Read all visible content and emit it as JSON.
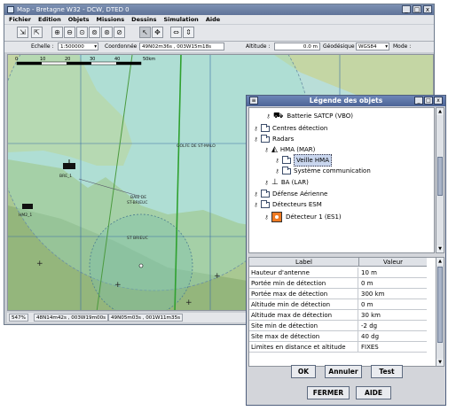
{
  "window": {
    "title": "Map - Bretagne W32 - DCW, DTED 0",
    "minimize": "_",
    "maximize": "□",
    "close": "x"
  },
  "menu": [
    "Fichier",
    "Edition",
    "Objets",
    "Missions",
    "Dessins",
    "Simulation",
    "Aide"
  ],
  "infobar": {
    "scale_label": "Echelle :",
    "scale_value": "1:500000",
    "coord_label": "Coordonnée :",
    "coord_value": "49N02m36s , 003W15m18s",
    "altitude_label": "Altitude :",
    "altitude_value": "0.0 m",
    "geodesic_label": "Géodésique :",
    "geodesic_value": "WGS84",
    "mode_label": "Mode :"
  },
  "map": {
    "scale_ticks": [
      "0",
      "10",
      "20",
      "30",
      "40",
      "50km"
    ],
    "labels": {
      "golfe": [
        "GOLFE DE ST-MALO"
      ],
      "baie": [
        "BAIE DE",
        "ST-BRIEUC"
      ],
      "saint_brieuc": "ST BRIEUC",
      "unit1": "BRE_1",
      "unit2": "HM2_1"
    }
  },
  "status": {
    "zoom": "547%",
    "coord1": "48N14m42s , 003W19m00s",
    "coord2": "49N05m03s , 001W11m35s"
  },
  "legend": {
    "title": "Légende des objets",
    "tree": [
      {
        "label": "Batterie SATCP (VBO)"
      },
      {
        "label": "Centres détection"
      },
      {
        "label": "Radars"
      },
      {
        "label": "HMA (MAR)"
      },
      {
        "label": "Veille HMA"
      },
      {
        "label": "Système communication"
      },
      {
        "label": "BA (LAR)"
      },
      {
        "label": "Défense Aérienne"
      },
      {
        "label": "Détecteurs ESM"
      },
      {
        "label": "Détecteur 1 (ES1)"
      }
    ],
    "props_headers": [
      "Label",
      "Valeur"
    ],
    "props": [
      {
        "k": "Hauteur d'antenne",
        "v": "10 m"
      },
      {
        "k": "Portée min de détection",
        "v": "0 m"
      },
      {
        "k": "Portée max de détection",
        "v": "300 km"
      },
      {
        "k": "Altitude min de détection",
        "v": "0 m"
      },
      {
        "k": "Altitude max de détection",
        "v": "30 km"
      },
      {
        "k": "Site min de détection",
        "v": "-2 dg"
      },
      {
        "k": "Site max de détection",
        "v": "40 dg"
      },
      {
        "k": "Limites en distance et altitude",
        "v": "FIXES"
      }
    ],
    "buttons": {
      "ok": "OK",
      "cancel": "Annuler",
      "test": "Test",
      "close": "FERMER",
      "help": "AIDE"
    }
  }
}
